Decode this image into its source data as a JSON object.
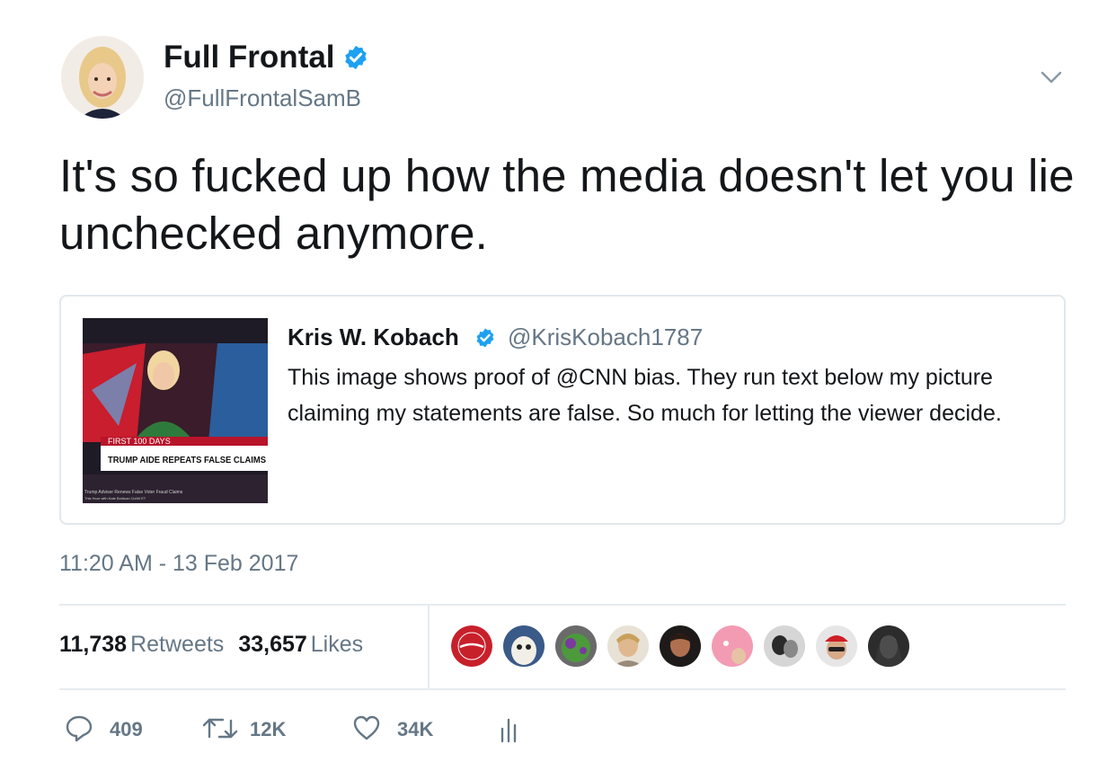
{
  "author": {
    "display_name": "Full Frontal",
    "handle": "@FullFrontalSamB",
    "avatar_icon": "profile-photo",
    "verified_icon": "verified-badge-icon"
  },
  "tweet": {
    "text": "It's so fucked up how the media doesn't let you lie unchecked anymore.",
    "timestamp": "11:20 AM - 13 Feb 2017"
  },
  "quoted_tweet": {
    "display_name": "Kris W. Kobach",
    "handle": "@KrisKobach1787",
    "text": "This image shows proof of @CNN bias. They run text below my picture claiming my statements are false. So much for letting the viewer decide.",
    "media": {
      "banner_top": "FIRST 100 DAYS",
      "banner_main": "TRUMP AIDE REPEATS FALSE CLAIMS",
      "ticker_line1": "Trump Adviser Renews False Voter Fraud Claims",
      "ticker_line2": "This Hour with Kate Bolduan   11AM ET"
    }
  },
  "stats": {
    "retweets_count": "11,738",
    "retweets_label": "Retweets",
    "likes_count": "33,657",
    "likes_label": "Likes"
  },
  "likers": [
    {
      "icon": "miller-time-bottlecap-avatar",
      "color": "#c8202b"
    },
    {
      "icon": "cartoon-character-avatar",
      "color": "#3a5a88"
    },
    {
      "icon": "green-alien-avatar",
      "color": "#3d7a3a"
    },
    {
      "icon": "person-avatar",
      "color": "#c9b59a"
    },
    {
      "icon": "person-selfie-avatar",
      "color": "#5a3a2e"
    },
    {
      "icon": "pink-avatar",
      "color": "#f39bb3"
    },
    {
      "icon": "black-white-photo-avatar",
      "color": "#6b6b6b"
    },
    {
      "icon": "man-red-hat-avatar",
      "color": "#b8b8b8"
    },
    {
      "icon": "dark-portrait-avatar",
      "color": "#4a4a4a"
    }
  ],
  "actions": {
    "reply_count": "409",
    "retweet_count": "12K",
    "like_count": "34K"
  },
  "colors": {
    "text_primary": "#14171a",
    "text_secondary": "#657786",
    "verified_blue": "#1da1f2",
    "border": "#e1e8ed"
  }
}
